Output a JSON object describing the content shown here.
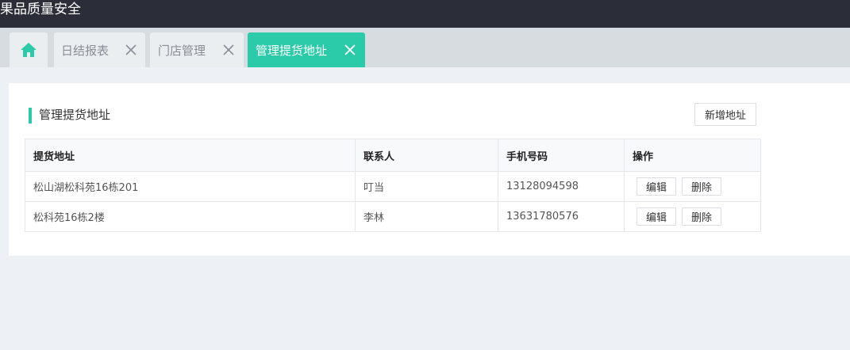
{
  "app": {
    "title": "果品质量安全"
  },
  "tabs": [
    {
      "label": "日结报表"
    },
    {
      "label": "门店管理"
    },
    {
      "label": "管理提货地址"
    }
  ],
  "section": {
    "title": "管理提货地址",
    "add_label": "新增地址"
  },
  "table": {
    "headers": [
      "提货地址",
      "联系人",
      "手机号码",
      "操作"
    ],
    "rows": [
      {
        "address": "松山湖松科苑16栋201",
        "contact": "叮当",
        "phone": "13128094598"
      },
      {
        "address": "松科苑16栋2楼",
        "contact": "李林",
        "phone": "13631780576"
      }
    ],
    "edit_label": "编辑",
    "delete_label": "删除"
  },
  "colors": {
    "accent": "#2bcaa9",
    "topbar": "#2b2e38"
  },
  "icons": {
    "home": "home-icon",
    "close": "close-icon"
  }
}
